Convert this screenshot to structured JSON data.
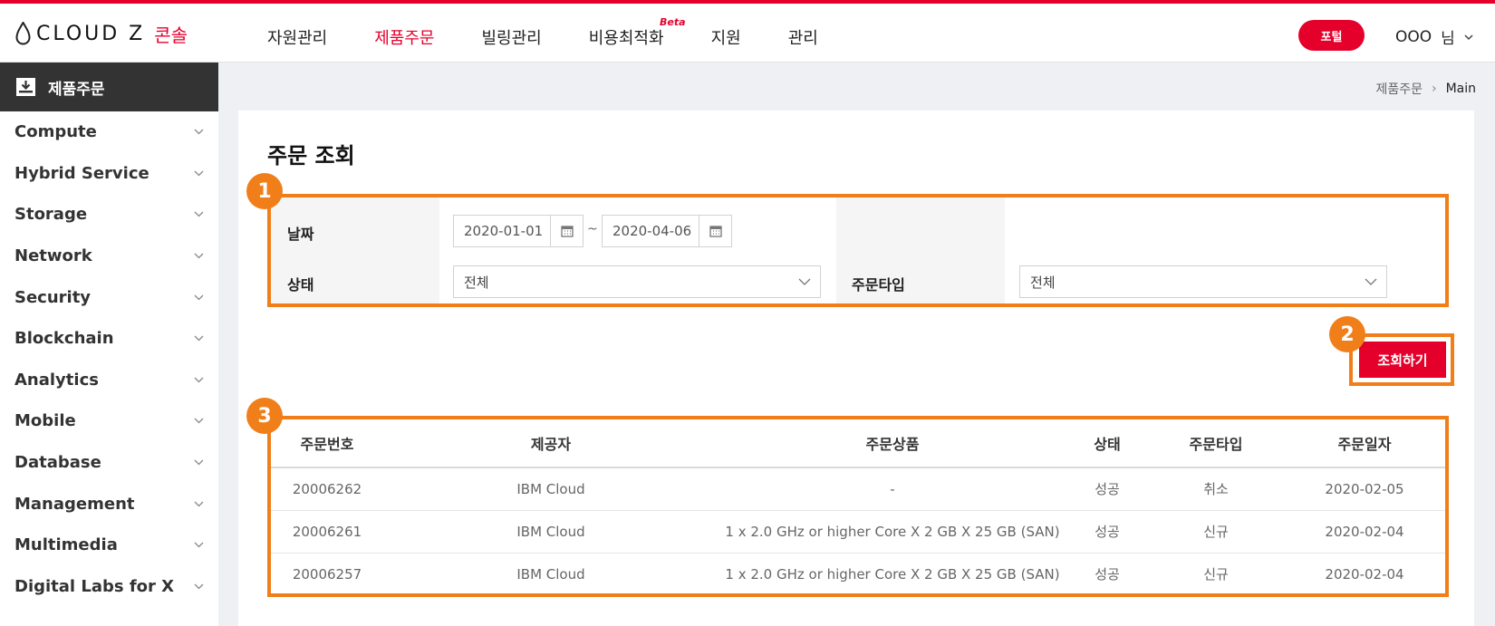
{
  "logo": {
    "brand": "CLOUD Z",
    "console": "콘솔"
  },
  "gnb": [
    {
      "label": "자원관리",
      "active": false
    },
    {
      "label": "제품주문",
      "active": true
    },
    {
      "label": "빌링관리",
      "active": false
    },
    {
      "label": "비용최적화",
      "active": false,
      "badge": "Beta"
    },
    {
      "label": "지원",
      "active": false
    },
    {
      "label": "관리",
      "active": false
    }
  ],
  "header": {
    "portal_label": "포털",
    "user_name": "OOO",
    "user_suffix": "님"
  },
  "sidebar": {
    "title": "제품주문",
    "items": [
      {
        "label": "Compute"
      },
      {
        "label": "Hybrid Service"
      },
      {
        "label": "Storage"
      },
      {
        "label": "Network"
      },
      {
        "label": "Security"
      },
      {
        "label": "Blockchain"
      },
      {
        "label": "Analytics"
      },
      {
        "label": "Mobile"
      },
      {
        "label": "Database"
      },
      {
        "label": "Management"
      },
      {
        "label": "Multimedia"
      },
      {
        "label": "Digital Labs for X"
      }
    ]
  },
  "breadcrumb": {
    "parent": "제품주문",
    "separator": "›",
    "current": "Main"
  },
  "page": {
    "title": "주문 조회"
  },
  "search": {
    "date_label": "날짜",
    "date_from": "2020-01-01",
    "date_sep": "~",
    "date_to": "2020-04-06",
    "status_label": "상태",
    "status_value": "전체",
    "order_type_label": "주문타입",
    "order_type_value": "전체",
    "query_label": "조회하기"
  },
  "callouts": {
    "one": "1",
    "two": "2",
    "three": "3"
  },
  "table": {
    "headers": [
      "주문번호",
      "제공자",
      "주문상품",
      "상태",
      "주문타입",
      "주문일자"
    ],
    "rows": [
      [
        "20006262",
        "IBM Cloud",
        "-",
        "성공",
        "취소",
        "2020-02-05"
      ],
      [
        "20006261",
        "IBM Cloud",
        "1 x 2.0 GHz or higher Core X 2 GB X 25 GB (SAN)",
        "성공",
        "신규",
        "2020-02-04"
      ],
      [
        "20006257",
        "IBM Cloud",
        "1 x 2.0 GHz or higher Core X 2 GB X 25 GB (SAN)",
        "성공",
        "신규",
        "2020-02-04"
      ]
    ]
  },
  "colors": {
    "brand_red": "#e4002b",
    "callout_orange": "#f07f1a",
    "sidebar_head": "#333333"
  }
}
